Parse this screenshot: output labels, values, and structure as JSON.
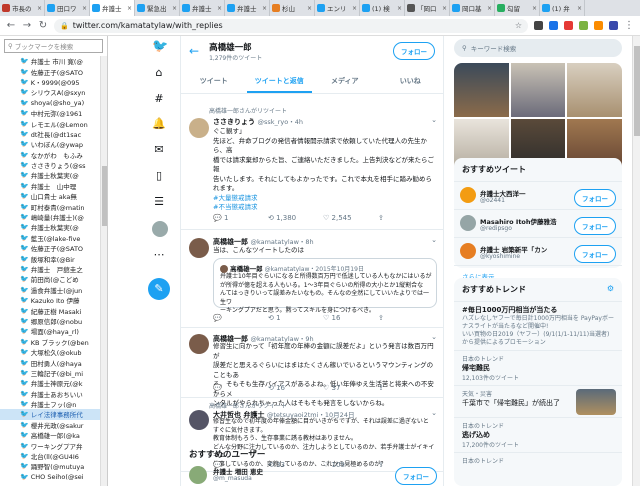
{
  "browser": {
    "tabs": [
      {
        "label": "市長の",
        "color": "#c0392b"
      },
      {
        "label": "田口ワ",
        "color": "#1da1f2"
      },
      {
        "label": "弁護士",
        "color": "#1da1f2",
        "active": true
      },
      {
        "label": "緊急出",
        "color": "#1da1f2"
      },
      {
        "label": "弁護士",
        "color": "#1da1f2"
      },
      {
        "label": "弁護士",
        "color": "#1da1f2"
      },
      {
        "label": "杉山",
        "color": "#e67e22"
      },
      {
        "label": "エンリ",
        "color": "#1da1f2"
      },
      {
        "label": "(1) 検",
        "color": "#1da1f2"
      },
      {
        "label": "「岡口",
        "color": "#555"
      },
      {
        "label": "岡口基",
        "color": "#1da1f2"
      },
      {
        "label": "勾留",
        "color": "#27ae60"
      },
      {
        "label": "(1) 弁",
        "color": "#1da1f2"
      }
    ],
    "url": "twitter.com/kamatatylaw/with_replies"
  },
  "bookmarks": {
    "search_placeholder": "ブックマークを検索",
    "items": [
      "弁護士 市川 寛(@",
      "佐藤正子(@SATO",
      "K・9999(@095",
      "シリウスA(@sxyn",
      "shoya(@sho_ya)",
      "中村元弥(@1961",
      "レモエル(@Lemon",
      "dt社長(@dt1sac",
      "いわぼん(@ywap",
      "なかがわ　もふみ",
      "ささきりょう(@ss",
      "弁護士秋葉実(@",
      "弁護士　山中理",
      "山口貴士 aka無",
      "町村泰貴(@matin",
      "嶋崎量(弁護士)(@",
      "弁護士秋葉実(@",
      "藍玉(@lake-five",
      "佐藤正子(@SATO",
      "飯塚和幸(@Bir",
      "弁護士　戸舘圭之",
      "前田尚(@こどめ",
      "過食弁護士(@jun",
      "Kazuko Ito 伊藤",
      "紀藤正樹 Masaki",
      "郷原信郎(@nobu",
      "場面(@haya_rl)",
      "KB ブラック(@ben",
      "大塚松久(@okub",
      "田村勇人(@haya",
      "三輪記子(@bi_mi",
      "弁護士神原元(@k",
      "弁護士あおちいい",
      "弁護士フッ(@n",
      "レイ法律事務所代",
      "櫻井光政(@sakur",
      "高橋雄一郎(@ka",
      "ワーキングプア弁",
      "北台(ll(@GU4I6",
      "踊野智(@mutuya",
      "CHO Seiho(@sei"
    ],
    "selected_index": 34
  },
  "profile": {
    "name": "高橋雄一郎",
    "sub": "1,279件のツイート",
    "follow_label": "フォロー",
    "tabs": [
      "ツイート",
      "ツイートと返信",
      "メディア",
      "いいね"
    ]
  },
  "tweets": [
    {
      "rt": "高橋雄一郎さんがリツイート",
      "name": "ささきりょう",
      "handle": "@ssk_ryo・4h",
      "lines": [
        "ぐこ観す」",
        "先ほど、弁命ブログの発信者情報開示請求で依頼していた代理人の先生から、高",
        "橋では請求棄却からた旨、ご連絡いただきました。上告判決などが来たらご報",
        "告いたします。それにしてもよかったです。これで本丸を相手に踏み勧められます。"
      ],
      "tags": [
        "#大量懲戒請求",
        "#不当懲戒請求"
      ],
      "replies": "1",
      "retweets": "1,380",
      "likes": "2,545"
    },
    {
      "name": "高橋雄一郎",
      "handle": "@kamatatylaw・8h",
      "lines": [
        "当は、こんなツイートしたのは"
      ],
      "quote": {
        "name": "高橋雄一郎",
        "handle": "@kamatatylaw・2015年10月19日",
        "lines": [
          "弁護士10年目ぐらいになると所得数百万円で低迷している人もなかにはいるが",
          "が所得が億を超える人もいる。1〜3年目ぐらいの所得の大小とか1縦割合な",
          "んてはっきりいって誤差みたいなもの。そんなの全然にしていいたよりでは一生ワ",
          "ーキングプアだと思う。黙ってスキルを身につけるべき。"
        ]
      },
      "replies": "",
      "retweets": "1",
      "likes": "16"
    },
    {
      "name": "高橋雄一郎",
      "handle": "@kamatatylaw・9h",
      "lines": [
        "修習生に向かって「初年度の年棒の金額に誤差だよ」という発言は数百万円が",
        "誤差だと思えるぐらいにはまはたくさん稼いでいるというマウンティングのこともあ",
        "る。そもそも生存バイアスがあるよね。低い年俸ゆえ生活苦と将来への不安からメ",
        "ンタルがやられちゃった人はそもそも発言をしないからね。"
      ],
      "replies": "",
      "retweets": "16",
      "likes": "37"
    },
    {
      "rt": "高橋雄一郎さんがリツイート",
      "name": "大井哲也 弁護士",
      "handle": "@tetsuyaoi2tmi・10月24日",
      "lines": [
        "修習生なので初年度の年俸金額に目がいきがちですが、それは誤差に過ぎないと",
        "すぐに気付きます。",
        "教育体制もろう、生存事業に誘る教材はありません。",
        "どんな分野に注力しているのか、注力しようとしているのか、若手弁護士がイキイキと",
        "仕事しているのか、変貌しているのか、これから見極めるのが？"
      ],
      "replies": "",
      "retweets": "33",
      "likes": "109"
    }
  ],
  "recommended": {
    "title": "おすすめのユーザー",
    "user_name": "弁護士 増田 恵史",
    "user_handle": "@m_masuda"
  },
  "right": {
    "search_placeholder": "キーワード検索",
    "rec_title": "おすすめツイート",
    "rec_users": [
      {
        "name": "弁護士大西洋一",
        "handle": "@o2441",
        "color": "#f39c12"
      },
      {
        "name": "Masahiro Itoh伊藤雅浩",
        "handle": "@redipsgo",
        "color": "#95a5a6"
      },
      {
        "name": "弁護士 岩築新平「カン",
        "handle": "@kyoshimine",
        "color": "#e67e22"
      }
    ],
    "follow_label": "フォロー",
    "more_label": "さらに表示",
    "trends_title": "おすすめトレンド",
    "trends": [
      {
        "small": "",
        "big": "#毎日1000万円相当が当たる",
        "desc": "ハズレなしヤフーで毎日計1000万円相当を PayPayボーナスライトが当たるなど開催中!",
        "promo": "いい買物の日2019（ヤフー）(9/1(1/1-11/11)当選者)から提供によるプロモーション"
      },
      {
        "small": "日本のトレンド",
        "big": "帰宅難民",
        "desc": "12,103件のツイート"
      },
      {
        "small": "天気・災害",
        "big": "",
        "desc": "千葉市で「帰宅難民」が続出了"
      },
      {
        "small": "日本のトレンド",
        "big": "逃げ込め",
        "desc": "17,200件のツイート"
      },
      {
        "small": "日本のトレンド",
        "big": "",
        "desc": ""
      }
    ]
  },
  "colors": {
    "accent": "#1da1f2"
  }
}
